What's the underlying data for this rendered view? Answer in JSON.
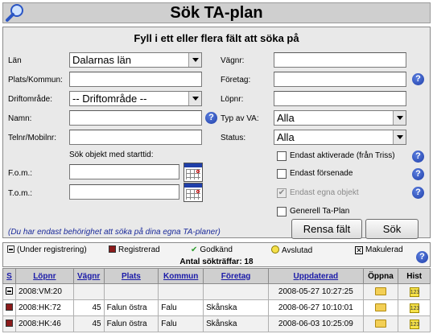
{
  "header": {
    "title": "Sök TA-plan",
    "icon": "magnifier-icon"
  },
  "form": {
    "heading": "Fyll i ett eller flera fält att söka på",
    "lan_label": "Län",
    "lan_value": "Dalarnas län",
    "plats_label": "Plats/Kommun:",
    "plats_value": "",
    "driftomrade_label": "Driftområde:",
    "driftomrade_value": "-- Driftområde --",
    "namn_label": "Namn:",
    "namn_value": "",
    "telnr_label": "Telnr/Mobilnr:",
    "telnr_value": "",
    "start_heading": "Sök objekt med starttid:",
    "fom_label": "F.o.m.:",
    "fom_value": "",
    "tom_label": "T.o.m.:",
    "tom_value": "",
    "vagnr_label": "Vägnr:",
    "vagnr_value": "",
    "foretag_label": "Företag:",
    "foretag_value": "",
    "lopnr_label": "Löpnr:",
    "lopnr_value": "",
    "typ_label": "Typ av VA:",
    "typ_value": "Alla",
    "status_label": "Status:",
    "status_value": "Alla",
    "chk_aktiverade": "Endast aktiverade (från Triss)",
    "chk_forsenade": "Endast försenade",
    "chk_egna": "Endast egna objekt",
    "chk_generell": "Generell Ta-Plan",
    "chk_aktiverade_checked": false,
    "chk_forsenade_checked": false,
    "chk_egna_checked": true,
    "chk_generell_checked": false,
    "reset_label": "Rensa fält",
    "search_label": "Sök",
    "note": "(Du har endast behörighet att söka på dina egna TA-planer)",
    "help_glyph": "?"
  },
  "legend": {
    "items": [
      {
        "label": "(Under registrering)",
        "color": "#000000"
      },
      {
        "label": "Registrerad",
        "color": "#8b1a1a"
      },
      {
        "label": "Godkänd",
        "color": "#2e9e2e"
      },
      {
        "label": "Avslutad",
        "color": "#e8c800"
      },
      {
        "label": "Makulerad",
        "color": "#333333"
      }
    ],
    "hits": "Antal sökträffar: 18"
  },
  "table": {
    "columns": [
      "S",
      "Löpnr",
      "Vägnr",
      "Plats",
      "Kommun",
      "Företag",
      "Uppdaterad",
      "Öppna",
      "Hist"
    ],
    "rows": [
      {
        "status": "under-registrering",
        "lopnr": "2008:VM:20",
        "vagnr": "",
        "plats": "",
        "kommun": "",
        "foretag": "",
        "uppdaterad": "2008-05-27 10:27:25"
      },
      {
        "status": "registrerad",
        "lopnr": "2008:HK:72",
        "vagnr": "45",
        "plats": "Falun östra",
        "kommun": "Falu",
        "foretag": "Skånska",
        "uppdaterad": "2008-06-27 10:10:01"
      },
      {
        "status": "registrerad",
        "lopnr": "2008:HK:46",
        "vagnr": "45",
        "plats": "Falun östra",
        "kommun": "Falu",
        "foretag": "Skånska",
        "uppdaterad": "2008-06-03 10:25:09"
      }
    ],
    "hist_glyph": "123"
  }
}
